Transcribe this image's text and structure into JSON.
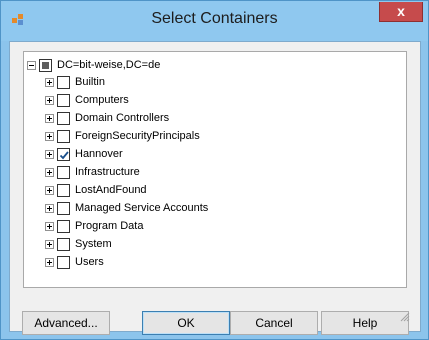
{
  "window": {
    "title": "Select Containers",
    "close_label": "x",
    "accent_color": "#8fc8ef"
  },
  "tree": {
    "root": {
      "label": "DC=bit-weise,DC=de",
      "state": "partial",
      "expanded": true
    },
    "children": [
      {
        "label": "Builtin",
        "checked": false
      },
      {
        "label": "Computers",
        "checked": false
      },
      {
        "label": "Domain Controllers",
        "checked": false
      },
      {
        "label": "ForeignSecurityPrincipals",
        "checked": false
      },
      {
        "label": "Hannover",
        "checked": true
      },
      {
        "label": "Infrastructure",
        "checked": false
      },
      {
        "label": "LostAndFound",
        "checked": false
      },
      {
        "label": "Managed Service Accounts",
        "checked": false
      },
      {
        "label": "Program Data",
        "checked": false
      },
      {
        "label": "System",
        "checked": false
      },
      {
        "label": "Users",
        "checked": false
      }
    ]
  },
  "buttons": {
    "advanced": "Advanced...",
    "ok": "OK",
    "cancel": "Cancel",
    "help": "Help"
  }
}
